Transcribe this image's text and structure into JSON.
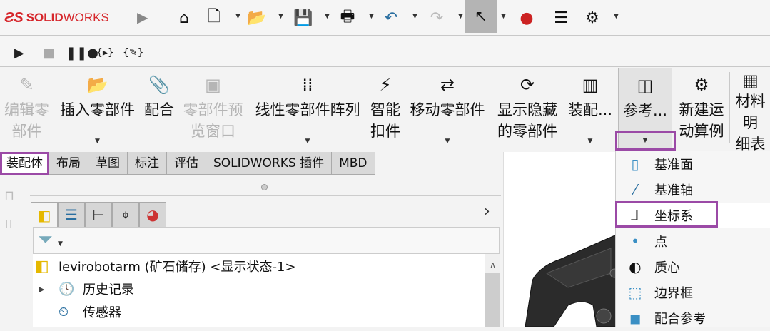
{
  "app": {
    "logo": "SOLIDWORKS",
    "logo_ds": "3S"
  },
  "quick_toolbar": [
    {
      "icon": "home-icon",
      "glyph": "⌂"
    },
    {
      "icon": "new-document-icon",
      "glyph": "🗋"
    },
    {
      "icon": "open-folder-icon",
      "glyph": "📂"
    },
    {
      "icon": "save-icon",
      "glyph": "💾"
    },
    {
      "icon": "print-icon",
      "glyph": "🖶"
    },
    {
      "icon": "undo-icon",
      "glyph": "↶"
    },
    {
      "icon": "redo-icon",
      "glyph": "↷"
    },
    {
      "icon": "select-cursor-icon",
      "glyph": "↖"
    },
    {
      "icon": "traffic-light-icon",
      "glyph": "●"
    },
    {
      "icon": "options-list-icon",
      "glyph": "☰"
    },
    {
      "icon": "settings-gear-icon",
      "glyph": "⚙"
    }
  ],
  "macro_toolbar": [
    {
      "icon": "play-macro-icon",
      "glyph": "▶"
    },
    {
      "icon": "stop-macro-icon",
      "glyph": "■"
    },
    {
      "icon": "pause-record-icon",
      "glyph": "❚❚●"
    },
    {
      "icon": "new-macro-icon",
      "glyph": "{▸}"
    },
    {
      "icon": "edit-macro-icon",
      "glyph": "{✎}"
    }
  ],
  "commands": [
    {
      "label": "编辑零\n部件",
      "glyph": "✎",
      "disabled": true
    },
    {
      "label": "插入零部件",
      "glyph": "📂",
      "dropdown": true
    },
    {
      "label": "配合",
      "glyph": "📎"
    },
    {
      "label": "零部件预\n览窗口",
      "glyph": "▣",
      "disabled": true
    },
    {
      "label": "线性零部件阵列",
      "glyph": "⁞⁞",
      "dropdown": true
    },
    {
      "label": "智能\n扣件",
      "glyph": "⚡"
    },
    {
      "label": "移动零部件",
      "glyph": "⇄",
      "dropdown": true
    },
    {
      "label": "显示隐藏\n的零部件",
      "glyph": "⟳"
    },
    {
      "label": "装配...",
      "glyph": "▥",
      "dropdown": true
    },
    {
      "label": "参考...",
      "glyph": "◫",
      "dropdown": true
    },
    {
      "label": "新建运\n动算例",
      "glyph": "⚙"
    },
    {
      "label": "材料明\n细表",
      "glyph": "▦"
    }
  ],
  "tabs": [
    "装配体",
    "布局",
    "草图",
    "标注",
    "评估",
    "SOLIDWORKS 插件",
    "MBD"
  ],
  "active_tab": "装配体",
  "reference_menu": [
    {
      "label": "基准面",
      "icon": "plane-icon",
      "glyph": "▯",
      "color": "#3a8fc4"
    },
    {
      "label": "基准轴",
      "icon": "axis-icon",
      "glyph": "⁄",
      "color": "#2a6fa0"
    },
    {
      "label": "坐标系",
      "icon": "coordinate-system-icon",
      "glyph": "⅃",
      "color": "#222"
    },
    {
      "label": "点",
      "icon": "point-icon",
      "glyph": "•",
      "color": "#3a8fc4"
    },
    {
      "label": "质心",
      "icon": "center-of-mass-icon",
      "glyph": "◐",
      "color": "#111"
    },
    {
      "label": "边界框",
      "icon": "bounding-box-icon",
      "glyph": "⬚",
      "color": "#3a8fc4"
    },
    {
      "label": "配合参考",
      "icon": "mate-reference-icon",
      "glyph": "◼",
      "color": "#3a8fc4"
    }
  ],
  "panel_tabs": [
    {
      "icon": "feature-manager-icon",
      "glyph": "◧"
    },
    {
      "icon": "property-manager-icon",
      "glyph": "☰"
    },
    {
      "icon": "configuration-manager-icon",
      "glyph": "⊢"
    },
    {
      "icon": "dimxpert-icon",
      "glyph": "⌖"
    },
    {
      "icon": "display-manager-icon",
      "glyph": "◕"
    }
  ],
  "tree": {
    "root": "levirobotarm (矿石储存) <显示状态-1>",
    "items": [
      {
        "label": "历史记录",
        "icon": "history-folder-icon",
        "glyph": "🕓",
        "expandable": true
      },
      {
        "label": "传感器",
        "icon": "sensor-folder-icon",
        "glyph": "⏲",
        "expandable": false
      }
    ]
  },
  "colors": {
    "highlight": "#9b4aa6",
    "brand": "#d6262b"
  }
}
